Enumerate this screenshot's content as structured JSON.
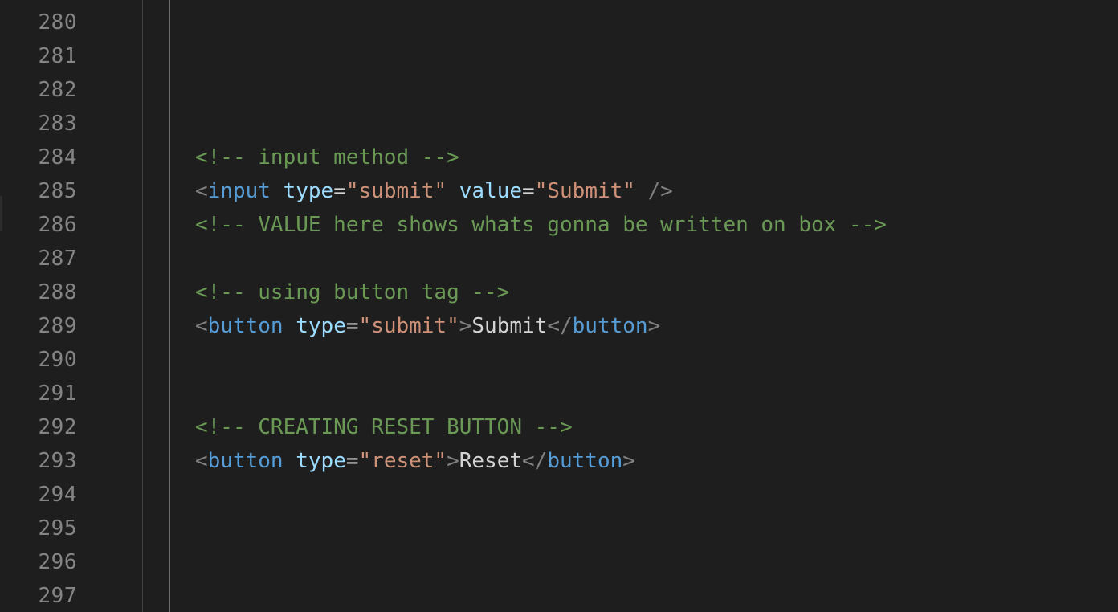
{
  "editor": {
    "line_numbers": [
      "280",
      "281",
      "282",
      "283",
      "284",
      "285",
      "286",
      "287",
      "288",
      "289",
      "290",
      "291",
      "292",
      "293",
      "294",
      "295",
      "296",
      "297"
    ],
    "code": {
      "l284": {
        "comment": "<!-- input method -->"
      },
      "l285": {
        "open": "<",
        "tag": "input",
        "attr1": "type",
        "eq1": "=",
        "val1": "\"submit\"",
        "attr2": "value",
        "eq2": "=",
        "val2": "\"Submit\"",
        "close": " />"
      },
      "l286": {
        "comment": "<!-- VALUE here shows whats gonna be written on box -->"
      },
      "l288": {
        "comment": "<!-- using button tag -->"
      },
      "l289": {
        "open": "<",
        "tag": "button",
        "attr1": "type",
        "eq1": "=",
        "val1": "\"submit\"",
        "gt": ">",
        "text": "Submit",
        "close_open": "</",
        "close_tag": "button",
        "close_gt": ">"
      },
      "l292": {
        "comment": "<!-- CREATING RESET BUTTON -->"
      },
      "l293": {
        "open": "<",
        "tag": "button",
        "attr1": "type",
        "eq1": "=",
        "val1": "\"reset\"",
        "gt": ">",
        "text": "Reset",
        "close_open": "</",
        "close_tag": "button",
        "close_gt": ">"
      }
    },
    "colors": {
      "background": "#1e1e1e",
      "line_number": "#858585",
      "comment": "#6a9955",
      "tag": "#569cd6",
      "attribute": "#9cdcfe",
      "string": "#ce9178",
      "punctuation": "#808080",
      "text": "#d4d4d4"
    }
  }
}
